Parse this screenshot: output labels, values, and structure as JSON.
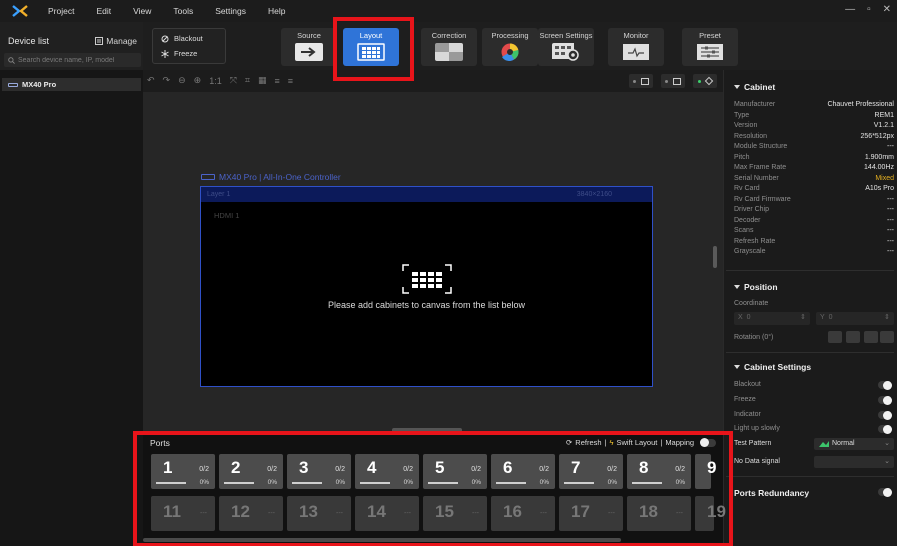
{
  "menu": {
    "items": [
      "Project",
      "Edit",
      "View",
      "Tools",
      "Settings",
      "Help"
    ]
  },
  "window_controls": [
    "—",
    "▫",
    "✕"
  ],
  "left_panel": {
    "title": "Device list",
    "manage_label": "Manage",
    "search_placeholder": "Search device name, IP, model",
    "device": "MX40 Pro"
  },
  "toolbar": {
    "blackout_label": "Blackout",
    "freeze_label": "Freeze",
    "buttons": [
      "Source",
      "Layout",
      "Correction",
      "Processing",
      "Screen Settings",
      "Monitor",
      "Preset"
    ],
    "active": "Layout"
  },
  "canvas": {
    "controller_title": "MX40 Pro | All-In-One Controller",
    "layer_name": "Layer 1",
    "layer_extra": "3840×2160",
    "input": "HDMI 1",
    "empty_message": "Please add cabinets to canvas from the list below"
  },
  "cabinet": {
    "title": "Cabinet",
    "rows": [
      {
        "k": "Manufacturer",
        "v": "Chauvet Professional"
      },
      {
        "k": "Type",
        "v": "REM1"
      },
      {
        "k": "Version",
        "v": "V1.2.1"
      },
      {
        "k": "Resolution",
        "v": "256*512px"
      },
      {
        "k": "Module Structure",
        "v": "---"
      },
      {
        "k": "Pitch",
        "v": "1.900mm"
      },
      {
        "k": "Max Frame Rate",
        "v": "144.00Hz"
      },
      {
        "k": "Serial Number",
        "v": "Mixed"
      },
      {
        "k": "Rv Card",
        "v": "A10s Pro"
      },
      {
        "k": "Rv Card Firmware",
        "v": "---"
      },
      {
        "k": "Driver Chip",
        "v": "---"
      },
      {
        "k": "Decoder",
        "v": "---"
      },
      {
        "k": "Scans",
        "v": "---"
      },
      {
        "k": "Refresh Rate",
        "v": "---"
      },
      {
        "k": "Grayscale",
        "v": "---"
      }
    ]
  },
  "position": {
    "title": "Position",
    "coordinate_label": "Coordinate",
    "x_label": "X",
    "x_value": "0",
    "y_label": "Y",
    "y_value": "0",
    "rotation_label": "Rotation (0°)"
  },
  "cabinet_settings": {
    "title": "Cabinet Settings",
    "blackout": "Blackout",
    "freeze": "Freeze",
    "indicator": "Indicator",
    "light_up": "Light up slowly",
    "test_pattern": "Test Pattern",
    "test_pattern_value": "Normal",
    "no_data": "No Data signal"
  },
  "ports_redundancy": "Ports Redundancy",
  "ports": {
    "title": "Ports",
    "refresh": "Refresh",
    "swift": "Swift Layout",
    "mapping": "Mapping",
    "active": [
      {
        "num": "1",
        "count": "0/2",
        "pct": "0%"
      },
      {
        "num": "2",
        "count": "0/2",
        "pct": "0%"
      },
      {
        "num": "3",
        "count": "0/2",
        "pct": "0%"
      },
      {
        "num": "4",
        "count": "0/2",
        "pct": "0%"
      },
      {
        "num": "5",
        "count": "0/2",
        "pct": "0%"
      },
      {
        "num": "6",
        "count": "0/2",
        "pct": "0%"
      },
      {
        "num": "7",
        "count": "0/2",
        "pct": "0%"
      },
      {
        "num": "8",
        "count": "0/2",
        "pct": "0%"
      },
      {
        "num": "9",
        "count": "",
        "pct": ""
      }
    ],
    "inactive": [
      "11",
      "12",
      "13",
      "14",
      "15",
      "16",
      "17",
      "18",
      "19"
    ],
    "inactive_dash": "---"
  },
  "colors": {
    "accent": "#2f74d8",
    "highlight": "#e8141a",
    "mixed": "#e5b020"
  }
}
